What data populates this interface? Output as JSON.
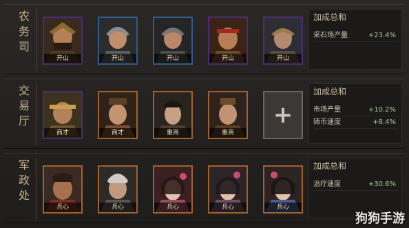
{
  "rows": [
    {
      "title": "农务司",
      "cards": [
        {
          "tag": "开山"
        },
        {
          "tag": "开山"
        },
        {
          "tag": "开山"
        },
        {
          "tag": "开山"
        },
        {
          "tag": "开山"
        }
      ],
      "bonus": {
        "heading": "加成总和",
        "lines": [
          {
            "label": "采石场产量",
            "value": "+23.4%"
          }
        ]
      }
    },
    {
      "title": "交易厅",
      "cards": [
        {
          "tag": "商才"
        },
        {
          "tag": "商才"
        },
        {
          "tag": "重商"
        },
        {
          "tag": "重商"
        }
      ],
      "bonus": {
        "heading": "加成总和",
        "lines": [
          {
            "label": "市场产量",
            "value": "+10.2%"
          },
          {
            "label": "铸币速度",
            "value": "+8.4%"
          }
        ]
      }
    },
    {
      "title": "军政处",
      "cards": [
        {
          "tag": "兵心"
        },
        {
          "tag": "兵心"
        },
        {
          "tag": "兵心"
        },
        {
          "tag": "兵心"
        },
        {
          "tag": "兵心"
        }
      ],
      "bonus": {
        "heading": "加成总和",
        "lines": [
          {
            "label": "治疗速度",
            "value": "+30.6%"
          }
        ]
      }
    }
  ],
  "add_slot": {
    "icon": "plus-icon"
  },
  "watermark": "狗狗手游"
}
